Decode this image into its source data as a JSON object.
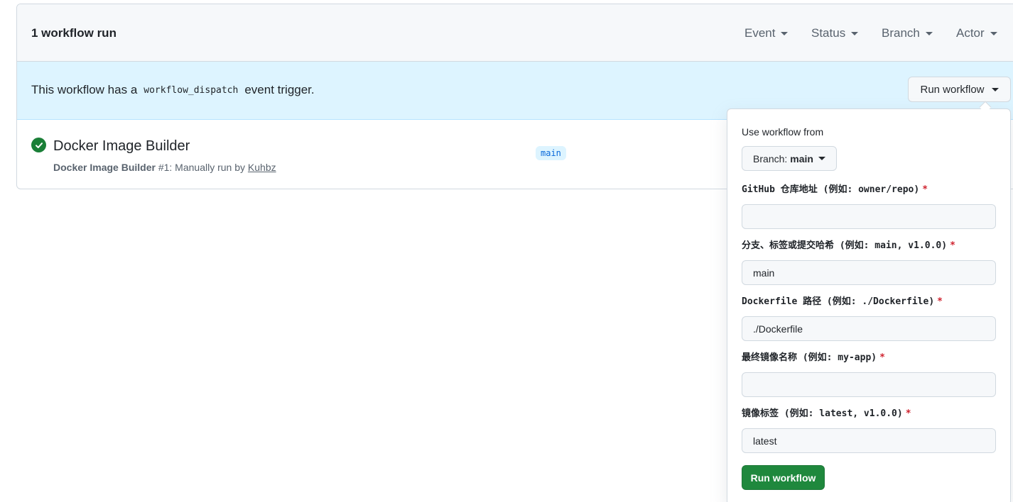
{
  "header": {
    "title": "1 workflow run",
    "filters": [
      {
        "label": "Event"
      },
      {
        "label": "Status"
      },
      {
        "label": "Branch"
      },
      {
        "label": "Actor"
      }
    ]
  },
  "banner": {
    "text_before": "This workflow has a",
    "code": "workflow_dispatch",
    "text_after": "event trigger.",
    "run_button": "Run workflow"
  },
  "run": {
    "title": "Docker Image Builder",
    "meta_name": "Docker Image Builder",
    "meta_number": "#1: Manually run by",
    "actor": "Kuhbz",
    "branch": "main"
  },
  "popover": {
    "heading": "Use workflow from",
    "branch_prefix": "Branch:",
    "branch_value": "main",
    "required_mark": "*",
    "fields": [
      {
        "label": "GitHub 仓库地址 (例如: owner/repo)",
        "value": ""
      },
      {
        "label": "分支、标签或提交哈希 (例如: main, v1.0.0)",
        "value": "main"
      },
      {
        "label": "Dockerfile 路径 (例如: ./Dockerfile)",
        "value": "./Dockerfile"
      },
      {
        "label": "最终镜像名称 (例如: my-app)",
        "value": ""
      },
      {
        "label": "镜像标签 (例如: latest, v1.0.0)",
        "value": "latest"
      }
    ],
    "submit": "Run workflow"
  },
  "colors": {
    "success": "#1a7f37",
    "primary_button": "#1f883d",
    "banner_bg": "#ddf4ff",
    "required": "#cf222e"
  }
}
